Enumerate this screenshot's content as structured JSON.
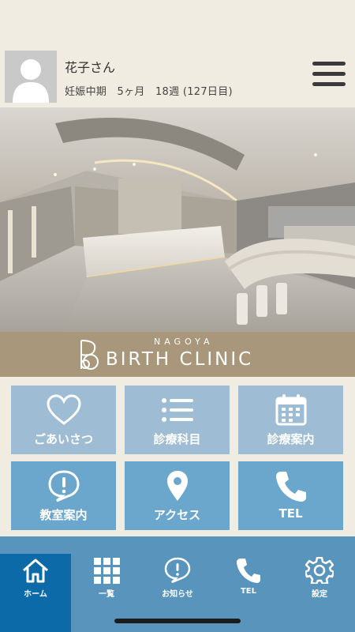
{
  "user": {
    "name": "花子さん",
    "pregnancy_info": "妊娠中期　5ヶ月　18週 (127日目)"
  },
  "header": {
    "menu_icon": "hamburger-menu-icon"
  },
  "logo": {
    "city": "NAGOYA",
    "clinic": "BIRTH CLINIC"
  },
  "tiles": [
    {
      "label": "ごあいさつ",
      "icon": "heart-icon",
      "tone": "light"
    },
    {
      "label": "診療科目",
      "icon": "list-icon",
      "tone": "light"
    },
    {
      "label": "診療案内",
      "icon": "calendar-icon",
      "tone": "light"
    },
    {
      "label": "教室案内",
      "icon": "exclamation-bubble-icon",
      "tone": "dark"
    },
    {
      "label": "アクセス",
      "icon": "map-pin-icon",
      "tone": "dark"
    },
    {
      "label": "TEL",
      "icon": "phone-icon",
      "tone": "dark"
    }
  ],
  "nav": [
    {
      "label": "ホーム",
      "icon": "home-icon",
      "active": true
    },
    {
      "label": "一覧",
      "icon": "grid-icon",
      "active": false
    },
    {
      "label": "お知らせ",
      "icon": "exclamation-bubble-icon",
      "active": false
    },
    {
      "label": "TEL",
      "icon": "phone-icon",
      "active": false
    },
    {
      "label": "設定",
      "icon": "gear-icon",
      "active": false
    }
  ],
  "colors": {
    "background": "#f1ece1",
    "logo_band": "#a8977a",
    "tile_light": "#9ebdd4",
    "tile_dark": "#6ba7cd",
    "nav_bar": "#5994bd",
    "nav_active": "#0c6aa8"
  }
}
